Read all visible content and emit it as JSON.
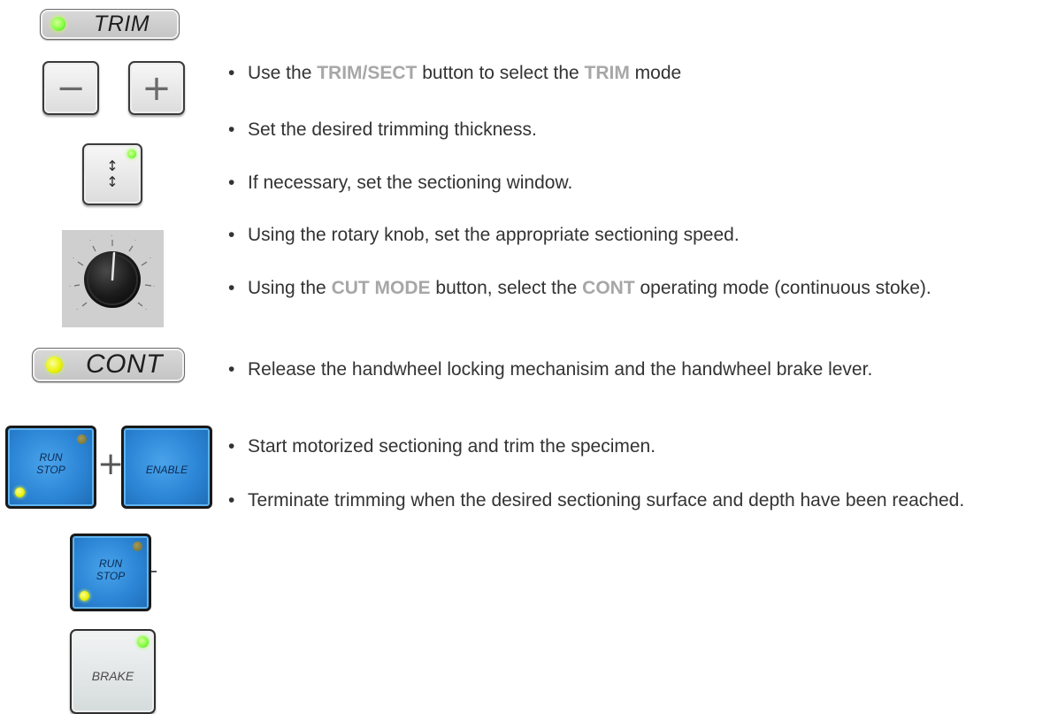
{
  "indicators": {
    "trim_label": "TRIM",
    "cont_label": "CONT"
  },
  "keys": {
    "minus": "−",
    "plus": "+",
    "arrow_up": "↕",
    "arrow_down": "↕",
    "run_stop_line1": "RUN",
    "run_stop_line2": "STOP",
    "combo_plus": "+",
    "enable": "ENABLE",
    "brake": "BRAKE"
  },
  "knob_icon": "rotary-speed-knob",
  "colors": {
    "keyword": "#a7a7a7",
    "text": "#333333",
    "blue_key": "#2c86d6",
    "led_green": "#7dff3c",
    "led_yellow": "#e9f000"
  },
  "bullet": "•",
  "steps": [
    {
      "parts": [
        {
          "t": "Use the "
        },
        {
          "t": "TRIM/SECT",
          "kw": true
        },
        {
          "t": " button to select the "
        },
        {
          "t": "TRIM",
          "kw": true
        },
        {
          "t": " mode"
        }
      ]
    },
    {
      "parts": [
        {
          "t": "Set the desired trimming  thickness."
        }
      ]
    },
    {
      "parts": [
        {
          "t": "If necessary, set the sectioning window."
        }
      ]
    },
    {
      "parts": [
        {
          "t": "Using the rotary knob, set the appropriate sectioning speed."
        }
      ]
    },
    {
      "parts": [
        {
          "t": "Using the "
        },
        {
          "t": "CUT MODE",
          "kw": true
        },
        {
          "t": " button, select the "
        },
        {
          "t": "CONT",
          "kw": true
        },
        {
          "t": " operating mode (continuous stoke)."
        }
      ]
    },
    {
      "parts": [
        {
          "t": "Release the handwheel locking mechanisim and the handwheel brake lever."
        }
      ]
    },
    {
      "parts": [
        {
          "t": "Start motorized sectioning and trim the specimen."
        }
      ]
    },
    {
      "parts": [
        {
          "t": "Terminate trimming when the desired sectioning surface and depth have been reached."
        }
      ]
    }
  ]
}
